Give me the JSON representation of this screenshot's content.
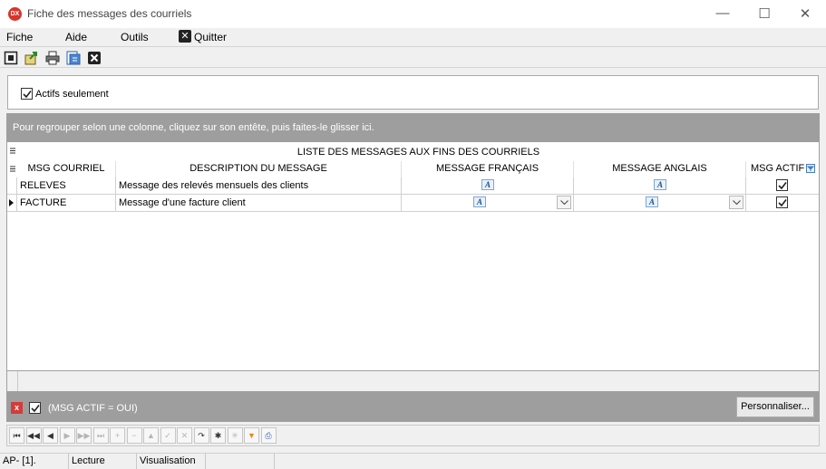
{
  "window": {
    "title": "Fiche des messages des courriels",
    "app_icon_text": "DX",
    "minimize_glyph": "—",
    "maximize_glyph": "☐",
    "close_glyph": "✕"
  },
  "menu": {
    "items": [
      "Fiche",
      "Aide",
      "Outils"
    ],
    "quit_label": "Quitter"
  },
  "toolbar": {
    "icons": [
      "fit-window-icon",
      "export-icon",
      "print-icon",
      "preview-icon",
      "close-icon"
    ]
  },
  "filter_panel": {
    "active_only_label": "Actifs seulement",
    "active_only_checked": true
  },
  "group_panel": {
    "hint": "Pour regrouper selon une colonne, cliquez sur son entête, puis faites-le glisser ici."
  },
  "grid": {
    "band_title": "LISTE DES MESSAGES AUX FINS DES COURRIELS",
    "columns": [
      "MSG COURRIEL",
      "DESCRIPTION DU MESSAGE",
      "MESSAGE FRANÇAIS",
      "MESSAGE ANGLAIS",
      "MSG ACTIF"
    ],
    "rows": [
      {
        "code": "RELEVES",
        "description": "Message des relevés mensuels des clients",
        "active": true,
        "current": false
      },
      {
        "code": "FACTURE",
        "description": "Message d'une facture client",
        "active": true,
        "current": true
      }
    ],
    "rich_text_icon": "A"
  },
  "filter_bar": {
    "clear_icon": "x",
    "enabled": true,
    "expression": "(MSG ACTIF = OUI)",
    "customize_label": "Personnaliser..."
  },
  "navigator": {
    "buttons": [
      {
        "name": "first-record-button",
        "glyph": "⏮",
        "enabled": true
      },
      {
        "name": "prev-page-button",
        "glyph": "◀◀",
        "enabled": true
      },
      {
        "name": "prev-record-button",
        "glyph": "◀",
        "enabled": true
      },
      {
        "name": "next-record-button",
        "glyph": "▶",
        "enabled": false
      },
      {
        "name": "next-page-button",
        "glyph": "▶▶",
        "enabled": false
      },
      {
        "name": "last-record-button",
        "glyph": "⏭",
        "enabled": false
      },
      {
        "name": "insert-button",
        "glyph": "+",
        "enabled": false
      },
      {
        "name": "delete-button",
        "glyph": "−",
        "enabled": false
      },
      {
        "name": "edit-button",
        "glyph": "▲",
        "enabled": false
      },
      {
        "name": "post-button",
        "glyph": "✓",
        "enabled": false
      },
      {
        "name": "cancel-button",
        "glyph": "✕",
        "enabled": false
      },
      {
        "name": "refresh-button",
        "glyph": "↷",
        "enabled": true
      },
      {
        "name": "bookmark-button",
        "glyph": "✱",
        "enabled": true
      },
      {
        "name": "goto-bookmark-button",
        "glyph": "✳",
        "enabled": false
      },
      {
        "name": "filter-button",
        "glyph": "▼",
        "enabled": true
      },
      {
        "name": "print-grid-button",
        "glyph": "⎙",
        "enabled": true
      }
    ]
  },
  "status": {
    "cells": [
      "AP- [1].",
      "Lecture",
      "Visualisation",
      "",
      ""
    ]
  },
  "colors": {
    "group_panel": "#9e9e9e",
    "accent_red": "#d33c3c",
    "filter_orange": "#e88a1a"
  }
}
